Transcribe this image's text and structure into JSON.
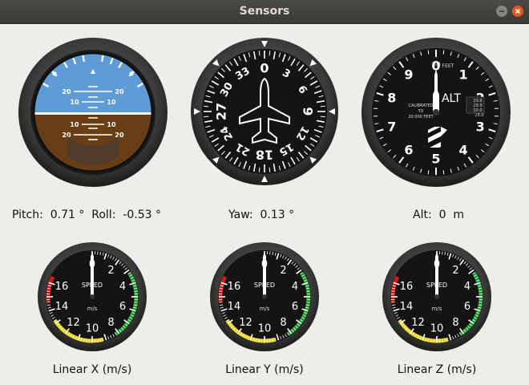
{
  "window": {
    "title": "Sensors"
  },
  "attitude": {
    "pitch_label": "Pitch:",
    "pitch_value": "0.71",
    "pitch_unit": "°",
    "roll_label": "Roll:",
    "roll_value": "-0.53",
    "roll_unit": "°",
    "pitch_ticks": [
      "20",
      "10",
      "10",
      "20"
    ]
  },
  "heading": {
    "label": "Yaw:",
    "value": "0.13",
    "unit": "°",
    "dial_labels": [
      "0",
      "3",
      "6",
      "9",
      "12",
      "15",
      "18",
      "21",
      "24",
      "27",
      "30",
      "33"
    ]
  },
  "altimeter": {
    "label": "Alt:",
    "value": "0",
    "unit": "m",
    "face_text": "ALT",
    "feet_label": "FEET",
    "hundreds_label": "100",
    "calibration_text": [
      "CALIBRATED",
      "TO",
      "20 000 FEET"
    ],
    "digits": [
      "0",
      "1",
      "2",
      "3",
      "4",
      "5",
      "6",
      "7",
      "8",
      "9"
    ],
    "pressure_values": [
      "29.8",
      "29.9",
      "30.0",
      "28.0"
    ]
  },
  "speed_gauge": {
    "face_text": "SPEED",
    "unit_text": "m/s",
    "numbers": [
      "0",
      "2",
      "4",
      "6",
      "8",
      "10",
      "12",
      "14",
      "16"
    ],
    "colors": {
      "red": "#d11a1a",
      "yellow": "#e8d21a",
      "green": "#1a9a2a"
    }
  },
  "gauges": [
    {
      "caption": "Linear X (m/s)"
    },
    {
      "caption": "Linear Y (m/s)"
    },
    {
      "caption": "Linear Z (m/s)"
    }
  ]
}
